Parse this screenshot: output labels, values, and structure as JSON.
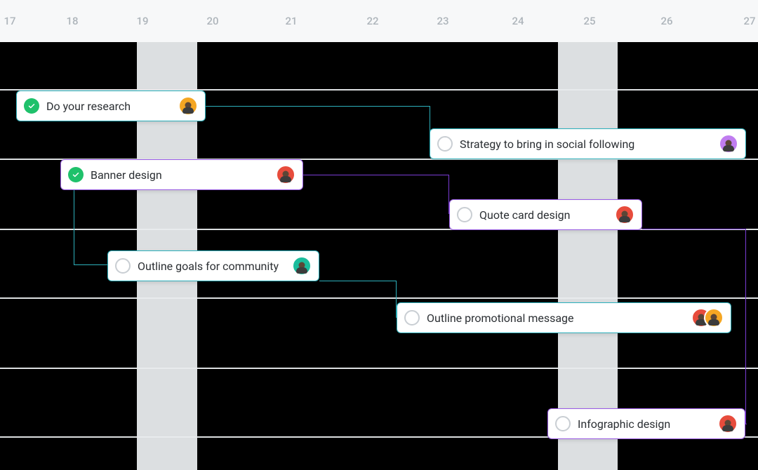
{
  "timeline": {
    "days": [
      "17",
      "18",
      "19",
      "20",
      "21",
      "22",
      "23",
      "24",
      "25",
      "26",
      "27"
    ]
  },
  "tasks": {
    "research": {
      "title": "Do your research",
      "done": true
    },
    "banner": {
      "title": "Banner design",
      "done": true
    },
    "goals": {
      "title": "Outline goals for community",
      "done": false
    },
    "strategy": {
      "title": "Strategy to bring in social following",
      "done": false
    },
    "quote": {
      "title": "Quote card design",
      "done": false
    },
    "promo": {
      "title": "Outline promotional message",
      "done": false
    },
    "infog": {
      "title": "Infographic design",
      "done": false
    }
  },
  "colors": {
    "teal": "#2db1bc",
    "purple": "#9b5de5",
    "done_green": "#1fc16b"
  }
}
